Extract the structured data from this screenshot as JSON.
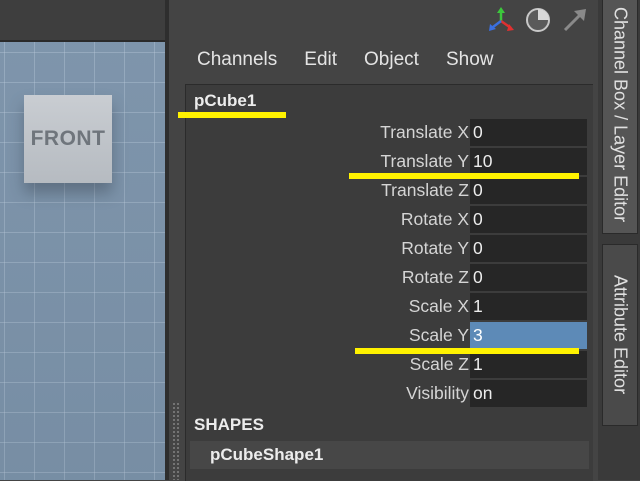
{
  "viewport": {
    "viewcube_label": "FRONT"
  },
  "toolbar_icons": [
    "axis-gizmo-icon",
    "pie-circle-icon",
    "arrow-icon"
  ],
  "menu": [
    "Channels",
    "Edit",
    "Object",
    "Show"
  ],
  "node": {
    "name": "pCube1"
  },
  "channels": [
    {
      "label": "Translate X",
      "value": "0"
    },
    {
      "label": "Translate Y",
      "value": "10"
    },
    {
      "label": "Translate Z",
      "value": "0"
    },
    {
      "label": "Rotate X",
      "value": "0"
    },
    {
      "label": "Rotate Y",
      "value": "0"
    },
    {
      "label": "Rotate Z",
      "value": "0"
    },
    {
      "label": "Scale X",
      "value": "1"
    },
    {
      "label": "Scale Y",
      "value": "3",
      "selected": true
    },
    {
      "label": "Scale Z",
      "value": "1"
    },
    {
      "label": "Visibility",
      "value": "on"
    }
  ],
  "shapes": {
    "title": "SHAPES",
    "name": "pCubeShape1"
  },
  "tabs": {
    "channel_box": "Channel Box / Layer Editor",
    "attribute_editor": "Attribute Editor"
  },
  "colors": {
    "highlight": "#fff200",
    "selection": "#5d8ab7"
  }
}
